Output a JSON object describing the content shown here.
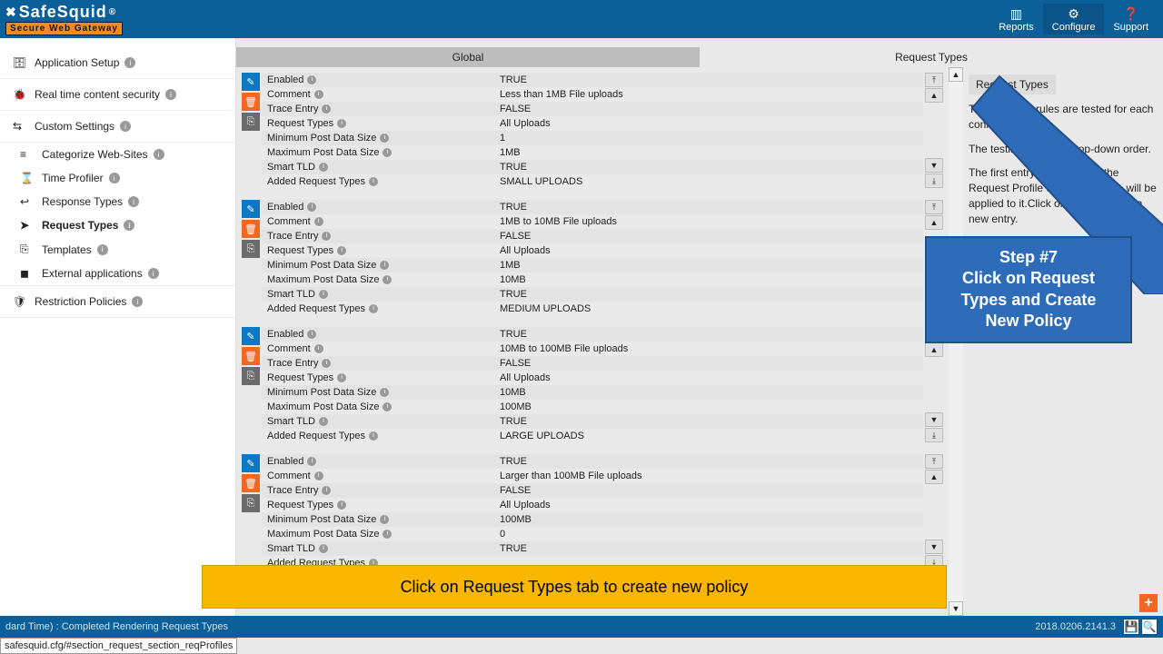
{
  "logo": {
    "name": "SafeSquid",
    "reg": "®",
    "tagline": "Secure Web Gateway"
  },
  "header_buttons": {
    "reports": "Reports",
    "configure": "Configure",
    "support": "Support"
  },
  "sidebar": {
    "app_setup": "Application Setup",
    "real_time": "Real time content security",
    "custom": "Custom Settings",
    "items": [
      {
        "icon": "≡",
        "label": "Categorize Web-Sites"
      },
      {
        "icon": "⌛",
        "label": "Time Profiler"
      },
      {
        "icon": "↩",
        "label": "Response Types"
      },
      {
        "icon": "➤",
        "label": "Request Types"
      },
      {
        "icon": "⎘",
        "label": "Templates"
      },
      {
        "icon": "◼",
        "label": "External applications"
      }
    ],
    "restriction": "Restriction Policies"
  },
  "tabs": {
    "global": "Global",
    "request_types": "Request Types"
  },
  "side_panel": {
    "title": "Request Types",
    "p1": "The following rules are tested for each connection.",
    "p2": "The testing is done in top-down order.",
    "p3": "The first entry that matches the Request Profile of a connection, will be applied to it.Click on below, to add a new entry."
  },
  "field_labels": {
    "enabled": "Enabled",
    "comment": "Comment",
    "trace": "Trace Entry",
    "reqtypes": "Request Types",
    "minpost": "Minimum Post Data Size",
    "maxpost": "Maximum Post Data Size",
    "smarttld": "Smart TLD",
    "added": "Added Request Types"
  },
  "rules": [
    {
      "enabled": "TRUE",
      "comment": "Less than 1MB File uploads",
      "trace": "FALSE",
      "reqtypes": "All Uploads",
      "minpost": "1",
      "maxpost": "1MB",
      "smarttld": "TRUE",
      "added": "SMALL UPLOADS"
    },
    {
      "enabled": "TRUE",
      "comment": "1MB to 10MB File uploads",
      "trace": "FALSE",
      "reqtypes": "All Uploads",
      "minpost": "1MB",
      "maxpost": "10MB",
      "smarttld": "TRUE",
      "added": "MEDIUM UPLOADS"
    },
    {
      "enabled": "TRUE",
      "comment": "10MB to 100MB File uploads",
      "trace": "FALSE",
      "reqtypes": "All Uploads",
      "minpost": "10MB",
      "maxpost": "100MB",
      "smarttld": "TRUE",
      "added": "LARGE UPLOADS"
    },
    {
      "enabled": "TRUE",
      "comment": "Larger than 100MB File uploads",
      "trace": "FALSE",
      "reqtypes": "All Uploads",
      "minpost": "100MB",
      "maxpost": "0",
      "smarttld": "TRUE",
      "added": ""
    }
  ],
  "callout": {
    "line1": "Step #7",
    "line2": "Click on Request",
    "line3": "Types and Create",
    "line4": "New Policy"
  },
  "banner": "Click on Request Types tab to create new policy",
  "footer": {
    "status": "dard Time) : Completed Rendering Request Types",
    "build": "2018.0206.2141.3"
  },
  "hover_url": "safesquid.cfg/#section_request_section_reqProfiles"
}
